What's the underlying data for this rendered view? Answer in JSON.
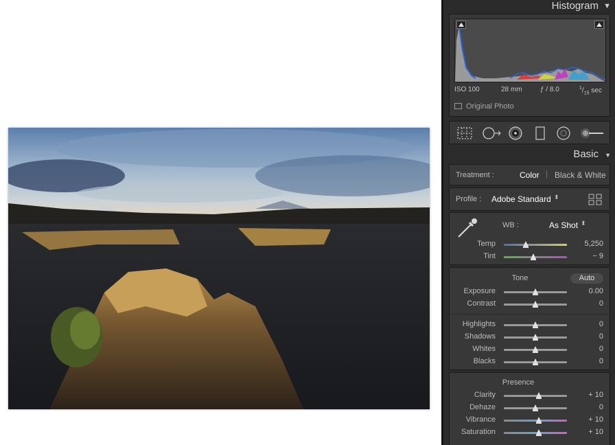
{
  "histogram": {
    "title": "Histogram",
    "iso": "ISO 100",
    "focal": "28 mm",
    "aperture": "ƒ / 8.0",
    "shutter_num": "1",
    "shutter_den": "15",
    "shutter_unit": "sec",
    "original_photo": "Original Photo"
  },
  "basic": {
    "title": "Basic",
    "treatment_label": "Treatment :",
    "treatment_color": "Color",
    "treatment_bw": "Black & White",
    "profile_label": "Profile :",
    "profile_value": "Adobe Standard",
    "wb_label": "WB :",
    "wb_value": "As Shot",
    "tone_title": "Tone",
    "auto_label": "Auto",
    "presence_title": "Presence"
  },
  "sliders": {
    "temp": {
      "label": "Temp",
      "value": "5,250",
      "pos": 0.35
    },
    "tint": {
      "label": "Tint",
      "value": "− 9",
      "pos": 0.47
    },
    "exposure": {
      "label": "Exposure",
      "value": "0.00",
      "pos": 0.5
    },
    "contrast": {
      "label": "Contrast",
      "value": "0",
      "pos": 0.5
    },
    "highlights": {
      "label": "Highlights",
      "value": "0",
      "pos": 0.5
    },
    "shadows": {
      "label": "Shadows",
      "value": "0",
      "pos": 0.5
    },
    "whites": {
      "label": "Whites",
      "value": "0",
      "pos": 0.5
    },
    "blacks": {
      "label": "Blacks",
      "value": "0",
      "pos": 0.5
    },
    "clarity": {
      "label": "Clarity",
      "value": "+ 10",
      "pos": 0.55
    },
    "dehaze": {
      "label": "Dehaze",
      "value": "0",
      "pos": 0.5
    },
    "vibrance": {
      "label": "Vibrance",
      "value": "+ 10",
      "pos": 0.55
    },
    "saturation": {
      "label": "Saturation",
      "value": "+ 10",
      "pos": 0.55
    }
  },
  "colors": {
    "panel_bg": "#2b2b2b",
    "section_bg": "#383838",
    "temp_gradient": "linear-gradient(90deg,#4f6fb0,#d8d060)",
    "tint_gradient": "linear-gradient(90deg,#5fb050,#b050c0)",
    "vib_gradient": "linear-gradient(90deg,#8a8a8a,#6aa0d0,#d060c0)"
  },
  "icons": {
    "crop": "crop-overlay-icon",
    "spot": "spot-removal-icon",
    "redeye": "red-eye-icon",
    "graduated": "graduated-filter-icon",
    "radial": "radial-filter-icon",
    "brush": "adjustment-brush-icon",
    "eyedropper": "eyedropper-icon",
    "grid": "profile-browser-icon"
  }
}
